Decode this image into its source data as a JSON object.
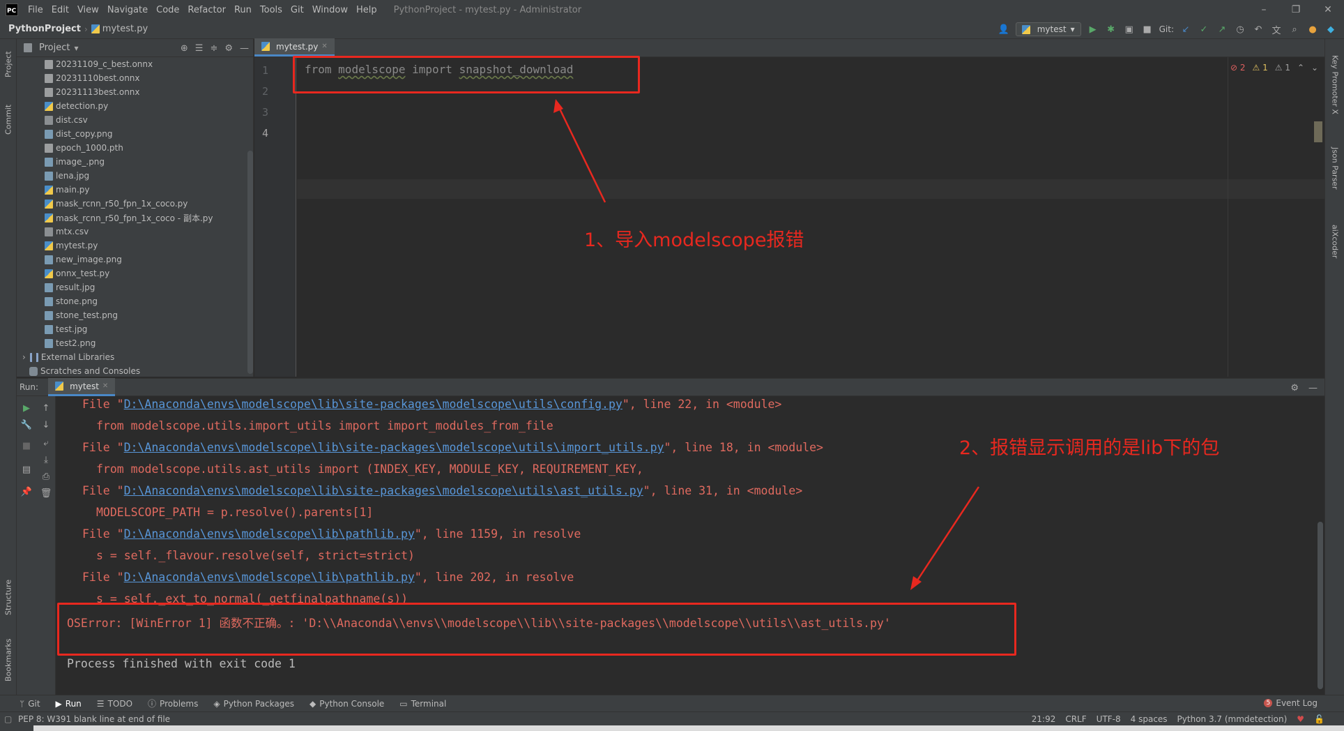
{
  "app": {
    "logo_text": "PC",
    "window_title": "PythonProject - mytest.py - Administrator",
    "menu": [
      "File",
      "Edit",
      "View",
      "Navigate",
      "Code",
      "Refactor",
      "Run",
      "Tools",
      "Git",
      "Window",
      "Help"
    ],
    "window_controls": [
      "–",
      "❐",
      "✕"
    ]
  },
  "nav": {
    "project": "PythonProject",
    "file": "mytest.py",
    "run_config": "mytest",
    "git_label": "Git:"
  },
  "left_strip": [
    "Project",
    "Commit",
    "Structure",
    "Bookmarks"
  ],
  "right_strip": [
    "Key Promoter X",
    "Json Parser",
    "aiXcoder"
  ],
  "project_panel": {
    "title": "Project",
    "files": [
      {
        "name": "20231109_c_best.onnx",
        "type": "onnx"
      },
      {
        "name": "20231110best.onnx",
        "type": "onnx"
      },
      {
        "name": "20231113best.onnx",
        "type": "onnx"
      },
      {
        "name": "detection.py",
        "type": "py"
      },
      {
        "name": "dist.csv",
        "type": "csv"
      },
      {
        "name": "dist_copy.png",
        "type": "img"
      },
      {
        "name": "epoch_1000.pth",
        "type": "pth"
      },
      {
        "name": "image_.png",
        "type": "img"
      },
      {
        "name": "lena.jpg",
        "type": "img"
      },
      {
        "name": "main.py",
        "type": "py"
      },
      {
        "name": "mask_rcnn_r50_fpn_1x_coco.py",
        "type": "py"
      },
      {
        "name": "mask_rcnn_r50_fpn_1x_coco - 副本.py",
        "type": "py"
      },
      {
        "name": "mtx.csv",
        "type": "csv"
      },
      {
        "name": "mytest.py",
        "type": "py"
      },
      {
        "name": "new_image.png",
        "type": "img"
      },
      {
        "name": "onnx_test.py",
        "type": "py"
      },
      {
        "name": "result.jpg",
        "type": "img"
      },
      {
        "name": "stone.png",
        "type": "img"
      },
      {
        "name": "stone_test.png",
        "type": "img"
      },
      {
        "name": "test.jpg",
        "type": "img"
      },
      {
        "name": "test2.png",
        "type": "img"
      }
    ],
    "external_libraries": "External Libraries",
    "scratches": "Scratches and Consoles"
  },
  "editor": {
    "tab": "mytest.py",
    "line_numbers": [
      "1",
      "2",
      "3",
      "4"
    ],
    "code": {
      "kw_from": "from",
      "module": "modelscope",
      "kw_import": "import",
      "name": "snapshot_download"
    },
    "inspections": {
      "errors": "2",
      "warnings": "1",
      "weak": "1"
    }
  },
  "annotations": {
    "a1": "1、导入modelscope报错",
    "a2": "2、报错显示调用的是lib下的包"
  },
  "run": {
    "label": "Run:",
    "tab": "mytest",
    "console": [
      {
        "indent": false,
        "pre": "File \"",
        "link": "D:\\Anaconda\\envs\\modelscope\\lib\\site-packages\\modelscope\\utils\\config.py",
        "post": "\", line 22, in <module>"
      },
      {
        "indent": true,
        "text": "from modelscope.utils.import_utils import import_modules_from_file"
      },
      {
        "indent": false,
        "pre": "File \"",
        "link": "D:\\Anaconda\\envs\\modelscope\\lib\\site-packages\\modelscope\\utils\\import_utils.py",
        "post": "\", line 18, in <module>"
      },
      {
        "indent": true,
        "text": "from modelscope.utils.ast_utils import (INDEX_KEY, MODULE_KEY, REQUIREMENT_KEY,"
      },
      {
        "indent": false,
        "pre": "File \"",
        "link": "D:\\Anaconda\\envs\\modelscope\\lib\\site-packages\\modelscope\\utils\\ast_utils.py",
        "post": "\", line 31, in <module>"
      },
      {
        "indent": true,
        "text": "MODELSCOPE_PATH = p.resolve().parents[1]"
      },
      {
        "indent": false,
        "pre": "File \"",
        "link": "D:\\Anaconda\\envs\\modelscope\\lib\\pathlib.py",
        "post": "\", line 1159, in resolve"
      },
      {
        "indent": true,
        "text": "s = self._flavour.resolve(self, strict=strict)"
      },
      {
        "indent": false,
        "pre": "File \"",
        "link": "D:\\Anaconda\\envs\\modelscope\\lib\\pathlib.py",
        "post": "\", line 202, in resolve"
      },
      {
        "indent": true,
        "text": "s = self._ext_to_normal(_getfinalpathname(s))"
      }
    ],
    "error": "OSError: [WinError 1] 函数不正确。: 'D:\\\\Anaconda\\\\envs\\\\modelscope\\\\lib\\\\site-packages\\\\modelscope\\\\utils\\\\ast_utils.py'",
    "exit": "Process finished with exit code 1"
  },
  "bottom_tabs": [
    "Git",
    "Run",
    "TODO",
    "Problems",
    "Python Packages",
    "Python Console",
    "Terminal"
  ],
  "event_log": "Event Log",
  "status": {
    "message": "PEP 8: W391 blank line at end of file",
    "position": "21:92",
    "line_sep": "CRLF",
    "encoding": "UTF-8",
    "indent": "4 spaces",
    "interpreter": "Python 3.7 (mmdetection)"
  },
  "colors": {
    "accent": "#4a88c7",
    "annotation": "#e8281f",
    "error_text": "#e06a5f",
    "link": "#5896d8"
  }
}
